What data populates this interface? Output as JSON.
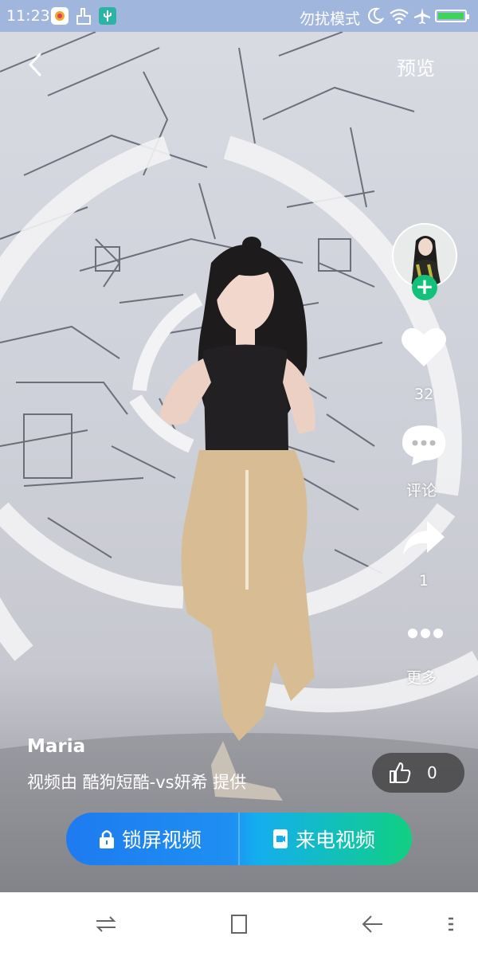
{
  "status_bar": {
    "time": "11:23",
    "dnd_label": "勿扰模式"
  },
  "header": {
    "back_icon": "chevron-left-icon",
    "preview_label": "预览"
  },
  "sidebar": {
    "like_count": "32",
    "comment_label": "评论",
    "share_count": "1",
    "more_label": "更多"
  },
  "info": {
    "username": "Maria",
    "credit": "视频由 酷狗短酷-vs妍希 提供",
    "like_pill_count": "0"
  },
  "actions": {
    "lockscreen_label": "锁屏视频",
    "incoming_call_label": "来电视频"
  },
  "colors": {
    "follow": "#13c27a",
    "cta_start": "#1e7bf0",
    "cta_end": "#10d080"
  }
}
